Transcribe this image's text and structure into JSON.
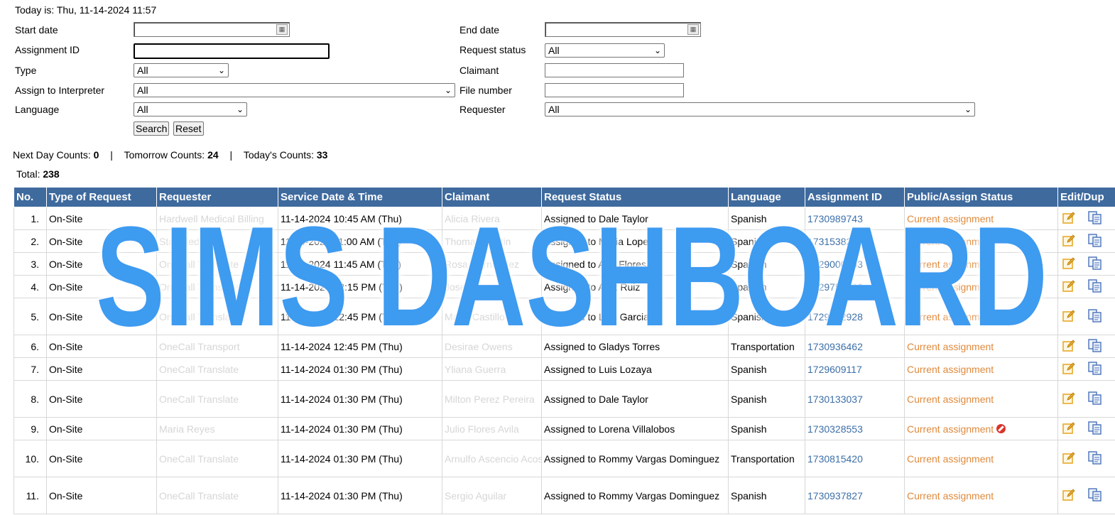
{
  "header": {
    "today": "Today is: Thu, 11-14-2024 11:57"
  },
  "filters": {
    "start_date_label": "Start date",
    "end_date_label": "End date",
    "start_date_value": "",
    "end_date_value": "",
    "assignment_id_label": "Assignment ID",
    "assignment_id_value": "",
    "request_status_label": "Request status",
    "request_status_value": "All",
    "type_label": "Type",
    "type_value": "All",
    "claimant_label": "Claimant",
    "claimant_value": "",
    "interpreter_label": "Assign to Interpreter",
    "interpreter_value": "All",
    "file_number_label": "File number",
    "file_number_value": "",
    "language_label": "Language",
    "language_value": "All",
    "requester_label": "Requester",
    "requester_value": "All",
    "search_label": "Search",
    "reset_label": "Reset"
  },
  "counts": {
    "next_day_label": "Next Day Counts:",
    "next_day_value": "0",
    "tomorrow_label": "Tomorrow Counts:",
    "tomorrow_value": "24",
    "today_label": "Today's Counts:",
    "today_value": "33",
    "separator": "|",
    "total_label": "Total:",
    "total_value": "238"
  },
  "table": {
    "columns": [
      "No.",
      "Type of Request",
      "Requester",
      "Service Date & Time",
      "Claimant",
      "Request Status",
      "Language",
      "Assignment ID",
      "Public/Assign Status",
      "Edit/Dup"
    ],
    "rows": [
      {
        "no": "1.",
        "type": "On-Site",
        "requester": "Hardwell Medical Billing",
        "datetime": "11-14-2024 10:45 AM (Thu)",
        "claimant": "Alicia Rivera",
        "status": "Assigned to Dale Taylor",
        "language": "Spanish",
        "assignment_id": "1730989743",
        "public_status": "Current assignment",
        "flag": false
      },
      {
        "no": "2.",
        "type": "On-Site",
        "requester": "Star Medical",
        "datetime": "11-14-2024 11:00 AM (Thu)",
        "claimant": "Thomas Martin",
        "status": "Assigned to Maria Lopez",
        "language": "Spanish",
        "assignment_id": "1731538210",
        "public_status": "Current assignment",
        "flag": false
      },
      {
        "no": "3.",
        "type": "On-Site",
        "requester": "OneCall Translate",
        "datetime": "11-14-2024 11:45 AM (Thu)",
        "claimant": "Rosa Hernandez",
        "status": "Assigned to Ana Flores",
        "language": "Spanish",
        "assignment_id": "1729000063",
        "public_status": "Current assignment",
        "flag": false
      },
      {
        "no": "4.",
        "type": "On-Site",
        "requester": "OneCall Translate",
        "datetime": "11-14-2024 12:15 PM (Thu)",
        "claimant": "Jose Ramirez",
        "status": "Assigned to Alex Ruiz",
        "language": "Spanish",
        "assignment_id": "1729750086",
        "public_status": "Current assignment",
        "flag": false
      },
      {
        "no": "5.",
        "type": "On-Site",
        "requester": "OneCall Translate",
        "datetime": "11-14-2024 12:45 PM (Thu)",
        "claimant": "Maria Castillo",
        "status": "Assigned to Luis Garcia",
        "language": "Spanish",
        "assignment_id": "1729922928",
        "public_status": "Current assignment",
        "flag": false
      },
      {
        "no": "6.",
        "type": "On-Site",
        "requester": "OneCall Transport",
        "datetime": "11-14-2024 12:45 PM (Thu)",
        "claimant": "Desirae Owens",
        "status": "Assigned to Gladys Torres",
        "language": "Transportation",
        "assignment_id": "1730936462",
        "public_status": "Current assignment",
        "flag": false
      },
      {
        "no": "7.",
        "type": "On-Site",
        "requester": "OneCall Translate",
        "datetime": "11-14-2024 01:30 PM (Thu)",
        "claimant": "Yliana Guerra",
        "status": "Assigned to Luis Lozaya",
        "language": "Spanish",
        "assignment_id": "1729609117",
        "public_status": "Current assignment",
        "flag": false
      },
      {
        "no": "8.",
        "type": "On-Site",
        "requester": "OneCall Translate",
        "datetime": "11-14-2024 01:30 PM (Thu)",
        "claimant": "Milton Perez Pereira",
        "status": "Assigned to Dale Taylor",
        "language": "Spanish",
        "assignment_id": "1730133037",
        "public_status": "Current assignment",
        "flag": false
      },
      {
        "no": "9.",
        "type": "On-Site",
        "requester": "Maria Reyes",
        "datetime": "11-14-2024 01:30 PM (Thu)",
        "claimant": "Julio Flores Avila",
        "status": "Assigned to Lorena Villalobos",
        "language": "Spanish",
        "assignment_id": "1730328553",
        "public_status": "Current assignment",
        "flag": true
      },
      {
        "no": "10.",
        "type": "On-Site",
        "requester": "OneCall Translate",
        "datetime": "11-14-2024 01:30 PM (Thu)",
        "claimant": "Arnulfo Ascencio Acosta",
        "status": "Assigned to Rommy Vargas Dominguez",
        "language": "Transportation",
        "assignment_id": "1730815420",
        "public_status": "Current assignment",
        "flag": false
      },
      {
        "no": "11.",
        "type": "On-Site",
        "requester": "OneCall Translate",
        "datetime": "11-14-2024 01:30 PM (Thu)",
        "claimant": "Sergio Aguilar",
        "status": "Assigned to Rommy Vargas Dominguez",
        "language": "Spanish",
        "assignment_id": "1730937827",
        "public_status": "Current assignment",
        "flag": false
      }
    ]
  },
  "watermark": {
    "text": "SIMS DASHBOARD",
    "color": "#3d9bf0"
  },
  "colors": {
    "header_bg": "#3e6a9e",
    "link": "#3c6fa8",
    "orange": "#e08a3c",
    "edit_icon": "#e7a92b",
    "dup_icon": "#4a72b8"
  }
}
